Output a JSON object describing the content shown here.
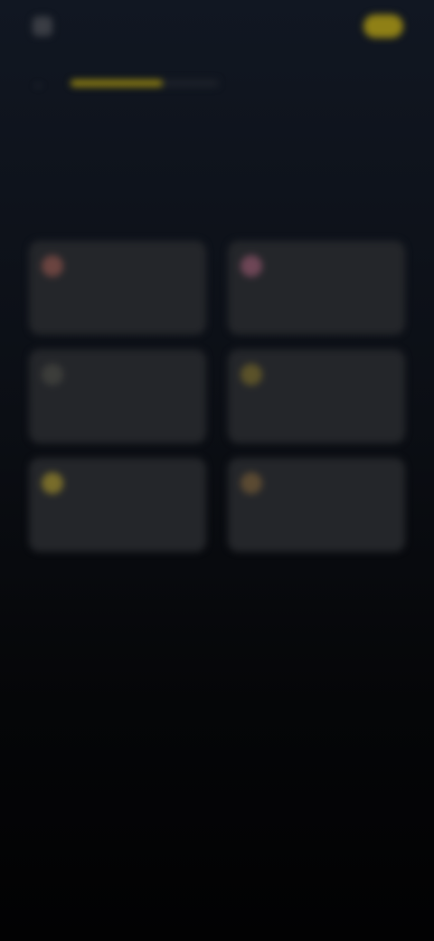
{
  "topbar": {
    "app_name": "",
    "skip_label": "",
    "cta_label": ""
  },
  "progress": {
    "fraction": 0.62
  },
  "heading": {
    "step_label": "",
    "title": ""
  },
  "options": [
    {
      "label": "",
      "icon": "heart-icon",
      "icon_color": "#6b4440"
    },
    {
      "label": "",
      "icon": "flower-icon",
      "icon_color": "#6e4656"
    },
    {
      "label": "",
      "icon": "circle-icon",
      "icon_color": "#3c3d3a"
    },
    {
      "label": "",
      "icon": "sun-icon",
      "icon_color": "#5b5229"
    },
    {
      "label": "",
      "icon": "star-icon",
      "icon_color": "#786c2a"
    },
    {
      "label": "",
      "icon": "leaf-icon",
      "icon_color": "#5b4a32"
    }
  ],
  "colors": {
    "accent": "#8f8016",
    "card_bg": "#24262a"
  }
}
